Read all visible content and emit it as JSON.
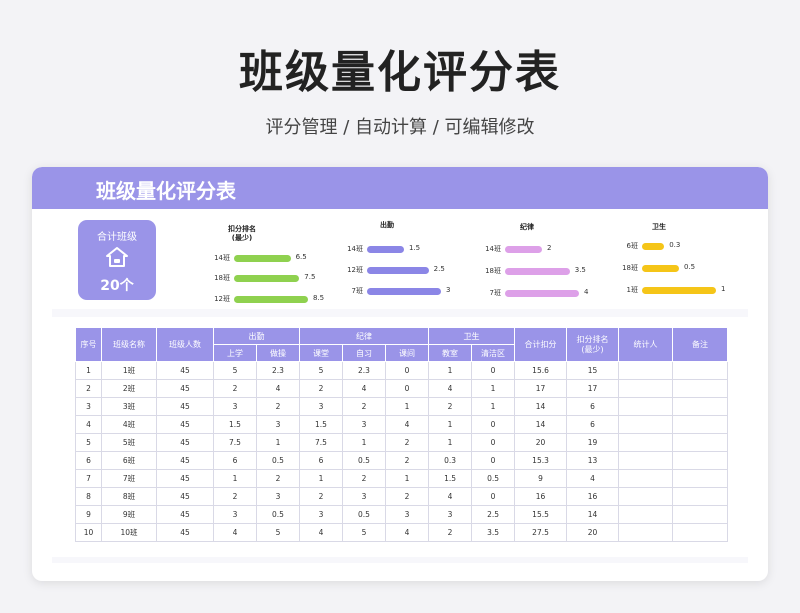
{
  "page": {
    "title": "班级量化评分表",
    "subtitle": "评分管理 / 自动计算 / 可编辑修改"
  },
  "card": {
    "title": "班级量化评分表"
  },
  "summary": {
    "label": "合计班级",
    "value": "20个",
    "icon": "home-icon"
  },
  "colors": {
    "accent": "#9a94e8",
    "green": "#8fd14f",
    "purple": "#8b86e6",
    "pink": "#dda0e8",
    "yellow": "#f5c518"
  },
  "chart_data": [
    {
      "type": "bar",
      "title": "扣分排名\n(最少)",
      "categories": [
        "14班",
        "18班",
        "12班"
      ],
      "values": [
        6.5,
        7.5,
        8.5
      ],
      "xlim": [
        0,
        8.5
      ]
    },
    {
      "type": "bar",
      "title": "出勤",
      "categories": [
        "14班",
        "12班",
        "7班"
      ],
      "values": [
        1.5,
        2.5,
        3
      ],
      "xlim": [
        0,
        3
      ]
    },
    {
      "type": "bar",
      "title": "纪律",
      "categories": [
        "14班",
        "18班",
        "7班"
      ],
      "values": [
        2,
        3.5,
        4
      ],
      "xlim": [
        0,
        4
      ]
    },
    {
      "type": "bar",
      "title": "卫生",
      "categories": [
        "6班",
        "18班",
        "1班"
      ],
      "values": [
        0.3,
        0.5,
        1
      ],
      "xlim": [
        0,
        1
      ]
    }
  ],
  "table": {
    "headers": {
      "index": "序号",
      "class_name": "班级名称",
      "headcount": "班级人数",
      "attendance": "出勤",
      "discipline": "纪律",
      "hygiene": "卫生",
      "total_deduction": "合计扣分",
      "rank": "扣分排名\n(最少)",
      "stat_person": "统计人",
      "note": "备注"
    },
    "sub_headers": {
      "school": "上学",
      "exercise": "做操",
      "classroom": "课堂",
      "self_study": "自习",
      "break": "课间",
      "room": "教室",
      "area": "清洁区"
    },
    "rows": [
      [
        "1",
        "1班",
        "45",
        "5",
        "2.3",
        "5",
        "2.3",
        "0",
        "1",
        "0",
        "15.6",
        "15",
        "",
        ""
      ],
      [
        "2",
        "2班",
        "45",
        "2",
        "4",
        "2",
        "4",
        "0",
        "4",
        "1",
        "17",
        "17",
        "",
        ""
      ],
      [
        "3",
        "3班",
        "45",
        "3",
        "2",
        "3",
        "2",
        "1",
        "2",
        "1",
        "14",
        "6",
        "",
        ""
      ],
      [
        "4",
        "4班",
        "45",
        "1.5",
        "3",
        "1.5",
        "3",
        "4",
        "1",
        "0",
        "14",
        "6",
        "",
        ""
      ],
      [
        "5",
        "5班",
        "45",
        "7.5",
        "1",
        "7.5",
        "1",
        "2",
        "1",
        "0",
        "20",
        "19",
        "",
        ""
      ],
      [
        "6",
        "6班",
        "45",
        "6",
        "0.5",
        "6",
        "0.5",
        "2",
        "0.3",
        "0",
        "15.3",
        "13",
        "",
        ""
      ],
      [
        "7",
        "7班",
        "45",
        "1",
        "2",
        "1",
        "2",
        "1",
        "1.5",
        "0.5",
        "9",
        "4",
        "",
        ""
      ],
      [
        "8",
        "8班",
        "45",
        "2",
        "3",
        "2",
        "3",
        "2",
        "4",
        "0",
        "16",
        "16",
        "",
        ""
      ],
      [
        "9",
        "9班",
        "45",
        "3",
        "0.5",
        "3",
        "0.5",
        "3",
        "3",
        "2.5",
        "15.5",
        "14",
        "",
        ""
      ],
      [
        "10",
        "10班",
        "45",
        "4",
        "5",
        "4",
        "5",
        "4",
        "2",
        "3.5",
        "27.5",
        "20",
        "",
        ""
      ]
    ]
  }
}
